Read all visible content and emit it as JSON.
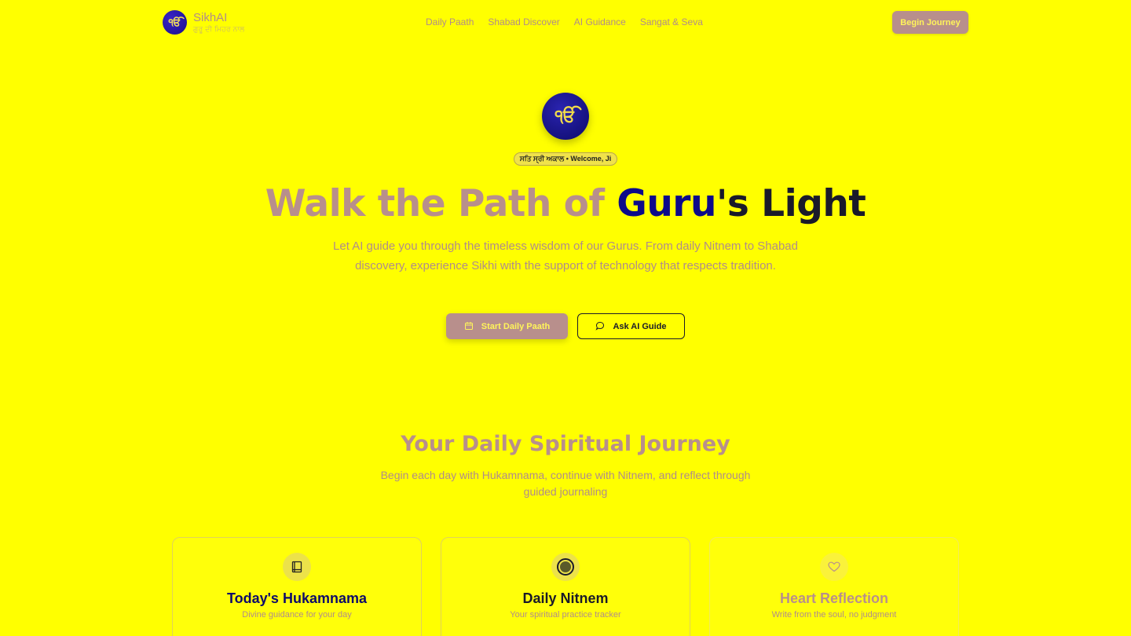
{
  "brand": {
    "logo_glyph": "ੴ",
    "name": "SikhAI",
    "tagline": "ਗੁਰੂ ਦੀ ਮਿਹਰ ਨਾਲ"
  },
  "nav": {
    "links": [
      "Daily Paath",
      "Shabad Discover",
      "AI Guidance",
      "Sangat & Seva"
    ],
    "cta": "Begin Journey"
  },
  "hero": {
    "logo_glyph": "ੴ",
    "badge": "ਸਤਿ ਸ੍ਰੀ ਅਕਾਲ • Welcome, Ji",
    "title_part1": "Walk the Path of ",
    "title_part2": "Guru",
    "title_part3": "'s Light",
    "description": "Let AI guide you through the timeless wisdom of our Gurus. From daily Nitnem to Shabad discovery, experience Sikhi with the support of technology that respects tradition.",
    "primary_button": "Start Daily Paath",
    "secondary_button": "Ask AI Guide"
  },
  "section": {
    "title": "Your Daily Spiritual Journey",
    "subtitle": "Begin each day with Hukamnama, continue with Nitnem, and reflect through guided journaling"
  },
  "cards": [
    {
      "icon": "book-icon",
      "title": "Today's Hukamnama",
      "subtitle": "Divine guidance for your day"
    },
    {
      "icon": "circle-progress-icon",
      "title": "Daily Nitnem",
      "subtitle": "Your spiritual practice tracker"
    },
    {
      "icon": "heart-icon",
      "title": "Heart Reflection",
      "subtitle": "Write from the soul, no judgment"
    }
  ],
  "colors": {
    "background": "#ffff00",
    "accent": "#b88f8c",
    "deep_blue": "#0d0a8a"
  }
}
